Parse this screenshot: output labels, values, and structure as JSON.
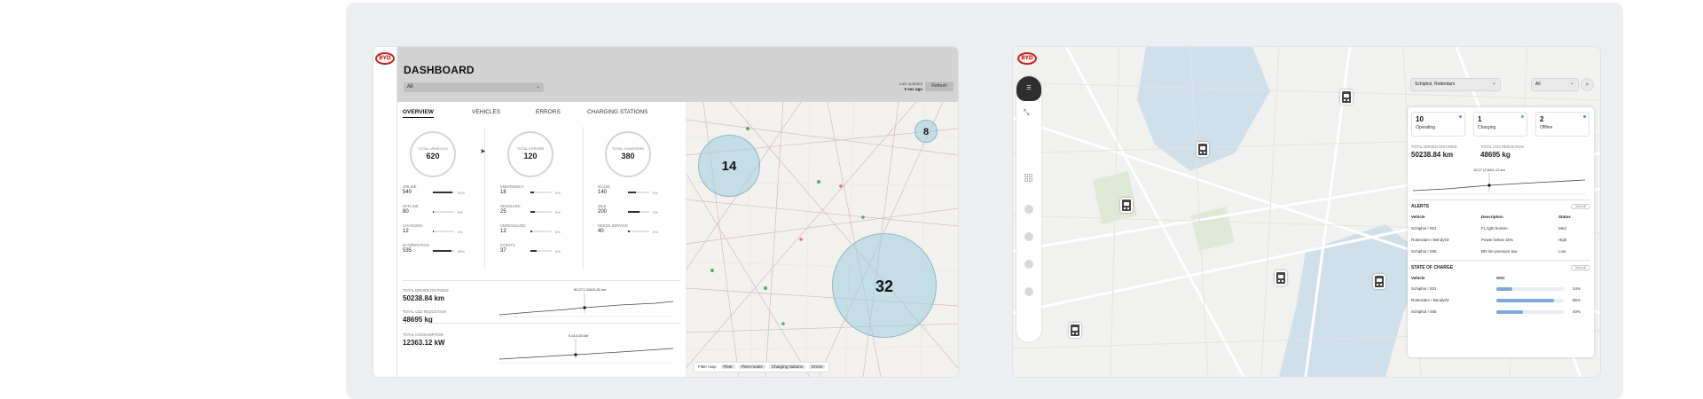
{
  "colors": {
    "brand_red": "#d0201c",
    "cluster_fill": "#9ecede",
    "soc_bar": "#7ea9dd"
  },
  "brand": {
    "logo_text": "BYD"
  },
  "dashboard": {
    "title": "DASHBOARD",
    "filter_value": "All",
    "last_updated_label": "Last updated",
    "last_updated_value": "0 sec ago",
    "refresh_label": "Refresh",
    "tabs": [
      "OVERVIEW",
      "VEHICLES",
      "ERRORS",
      "CHARGING STATIONS"
    ],
    "stat_columns": [
      {
        "circle_label": "TOTAL VEHICLES",
        "circle_value": "620",
        "rows": [
          {
            "label": "ONLINE",
            "value": "540",
            "pct": "92%",
            "fraction": 0.92
          },
          {
            "label": "OFFLINE",
            "value": "80",
            "pct": "5%",
            "fraction": 0.05
          },
          {
            "label": "CHARGING",
            "value": "12",
            "pct": "3%",
            "fraction": 0.03
          },
          {
            "label": "IN OPERATION",
            "value": "535",
            "pct": "88%",
            "fraction": 0.88
          }
        ]
      },
      {
        "circle_label": "TOTAL ERRORS",
        "circle_value": "120",
        "rows": [
          {
            "label": "EMERGENCY",
            "value": "18",
            "pct": "5%",
            "fraction": 0.15
          },
          {
            "label": "RESOLVED",
            "value": "25",
            "pct": "5%",
            "fraction": 0.2
          },
          {
            "label": "UNRESOLVED",
            "value": "12",
            "pct": "5%",
            "fraction": 0.1
          },
          {
            "label": "EVENTS",
            "value": "37",
            "pct": "5%",
            "fraction": 0.3
          }
        ]
      },
      {
        "circle_label": "TOTAL CHARGERS",
        "circle_value": "380",
        "rows": [
          {
            "label": "IN USE",
            "value": "140",
            "pct": "5%",
            "fraction": 0.37
          },
          {
            "label": "IDLE",
            "value": "200",
            "pct": "5%",
            "fraction": 0.53
          },
          {
            "label": "NEEDS SERVICE",
            "value": "40",
            "pct": "5%",
            "fraction": 0.1
          }
        ]
      }
    ],
    "metrics": [
      {
        "label": "TOTAL DRIVEN DISTANCE",
        "value": "50238.84 km",
        "spark_label": "50,271.32643.81 km"
      },
      {
        "label": "TOTAL CO2 REDUCTION",
        "value": "48695 kg"
      },
      {
        "label": "TOTAL CONSUMPTION",
        "value": "12363.12 kW",
        "spark_label": "9,413.28 kW"
      }
    ],
    "clusters": [
      "14",
      "8",
      "32"
    ],
    "filter_map_label": "Filter map:",
    "filter_chips": [
      "Fleet",
      "Fleet routes",
      "Charging stations",
      "Errors"
    ]
  },
  "map_view": {
    "route_select": "Schiphol, Rotterdam",
    "status_select": "All",
    "status_boxes": [
      {
        "value": "10",
        "label": "Operating",
        "color": "#4a90e2"
      },
      {
        "value": "1",
        "label": "Charging",
        "color": "#50c878"
      },
      {
        "value": "2",
        "label": "Offline",
        "color": "#4a90e2"
      }
    ],
    "distance_label": "TOTAL DRIVEN DISTANCE",
    "distance_value": "50238.84 km",
    "co2_label": "TOTAL CO2 REDUCTION",
    "co2_value": "48695 kg",
    "spark_label": "15,27 (2,840) 12 km",
    "alerts": {
      "title": "ALERTS",
      "view_all": "View all",
      "headers": [
        "Vehicle",
        "Description",
        "Status"
      ],
      "rows": [
        [
          "Schiphol / 001",
          "FL light broken",
          "Med"
        ],
        [
          "Rotterdam / Bendy03",
          "Power below 15%",
          "High"
        ],
        [
          "Schiphol / 005",
          "BR tire pressure low",
          "Low"
        ]
      ]
    },
    "soc": {
      "title": "STATE OF CHARGE",
      "view_all": "View all",
      "headers": [
        "Vehicle",
        "SOC"
      ],
      "rows": [
        {
          "vehicle": "Schiphol / 001",
          "pct": "24%",
          "fraction": 0.24
        },
        {
          "vehicle": "Rotterdam / Bendy03",
          "pct": "85%",
          "fraction": 0.85
        },
        {
          "vehicle": "Schiphol / 005",
          "pct": "40%",
          "fraction": 0.4
        }
      ]
    }
  }
}
